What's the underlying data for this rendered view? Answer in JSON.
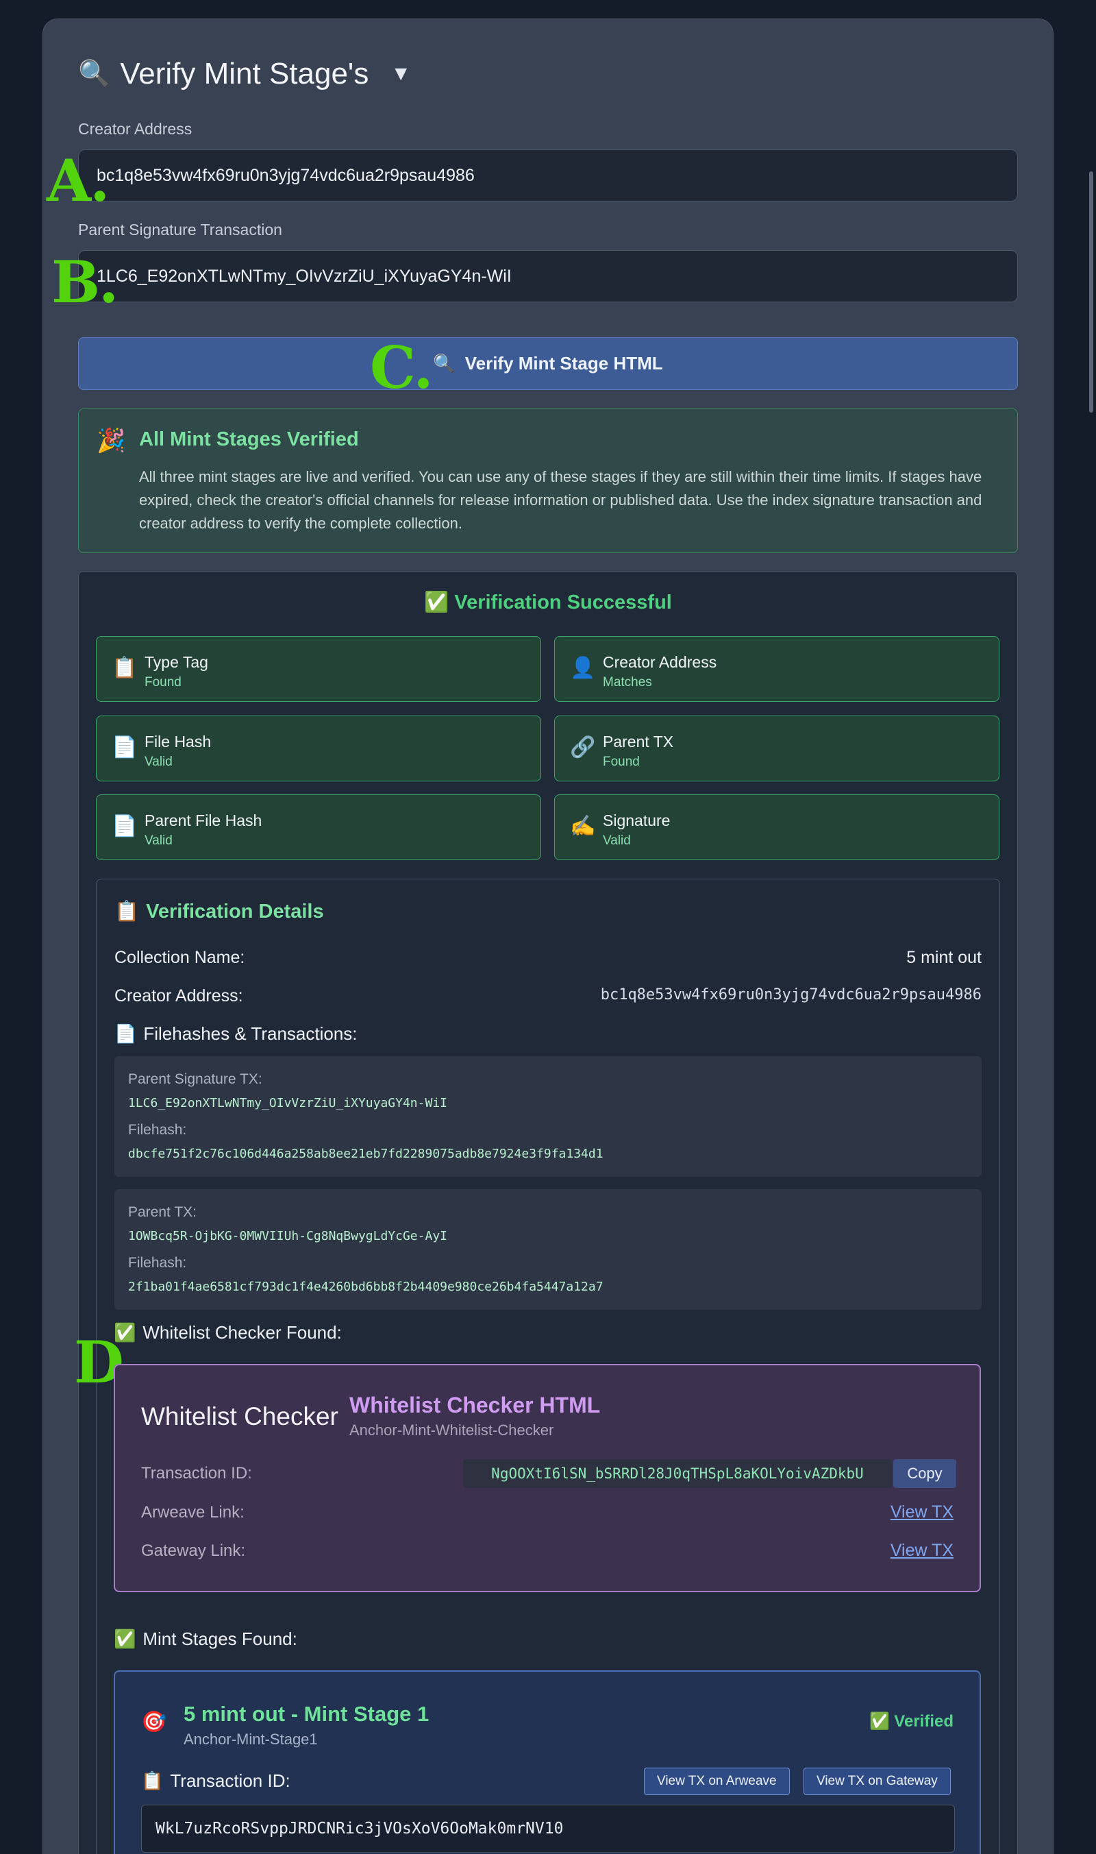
{
  "header": {
    "icon": "magnifier-icon",
    "title": "Verify Mint Stage's",
    "toggle_icon": "triangle-down-icon"
  },
  "form": {
    "creator_label": "Creator Address",
    "creator_value": "bc1q8e53vw4fx69ru0n3yjg74vdc6ua2r9psau4986",
    "parent_label": "Parent Signature Transaction",
    "parent_value": "1LC6_E92onXTLwNTmy_OIvVzrZiU_iXYuyaGY4n-WiI",
    "verify_icon": "magnifier-icon",
    "verify_label": "Verify Mint Stage HTML"
  },
  "annotations": {
    "a": "A.",
    "b": "B.",
    "c": "C.",
    "d": "D."
  },
  "alert": {
    "icon": "party-popper-icon",
    "title": "All Mint Stages Verified",
    "text": "All three mint stages are live and verified. You can use any of these stages if they are still within their time limits. If stages have expired, check the creator's official channels for release information or published data. Use the index signature transaction and creator address to verify the complete collection."
  },
  "verification": {
    "title": "✅ Verification Successful",
    "checks": [
      {
        "icon": "clipboard-icon",
        "name": "Type Tag",
        "status": "Found"
      },
      {
        "icon": "user-icon",
        "name": "Creator Address",
        "status": "Matches"
      },
      {
        "icon": "document-icon",
        "name": "File Hash",
        "status": "Valid"
      },
      {
        "icon": "link-icon",
        "name": "Parent TX",
        "status": "Found"
      },
      {
        "icon": "document-icon",
        "name": "Parent File Hash",
        "status": "Valid"
      },
      {
        "icon": "writing-hand-icon",
        "name": "Signature",
        "status": "Valid"
      }
    ]
  },
  "details": {
    "title": "Verification Details",
    "collection_label": "Collection Name:",
    "collection_value": "5 mint out",
    "creator_label": "Creator Address:",
    "creator_value": "bc1q8e53vw4fx69ru0n3yjg74vdc6ua2r9psau4986",
    "filehashes_title": "Filehashes & Transactions:",
    "blocks": [
      {
        "k1": "Parent Signature TX:",
        "v1": "1LC6_E92onXTLwNTmy_OIvVzrZiU_iXYuyaGY4n-WiI",
        "k2": "Filehash:",
        "v2": "dbcfe751f2c76c106d446a258ab8ee21eb7fd2289075adb8e7924e3f9fa134d1"
      },
      {
        "k1": "Parent TX:",
        "v1": "1OWBcq5R-OjbKG-0MWVIIUh-Cg8NqBwygLdYcGe-AyI",
        "k2": "Filehash:",
        "v2": "2f1ba01f4ae6581cf793dc1f4e4260bd6bb8f2b4409e980ce26b4fa5447a12a7"
      }
    ]
  },
  "whitelist": {
    "section_title": "Whitelist Checker Found:",
    "heading": "Whitelist Checker",
    "name": "Whitelist Checker HTML",
    "subtitle": "Anchor-Mint-Whitelist-Checker",
    "tx_label": "Transaction ID:",
    "tx_value": "NgOOXtI6lSN_bSRRDl28J0qTHSpL8aKOLYoivAZDkbU",
    "copy_label": "Copy",
    "arweave_label": "Arweave Link:",
    "arweave_link": "View TX",
    "gateway_label": "Gateway Link:",
    "gateway_link": "View TX"
  },
  "mint_stages": {
    "section_title": "Mint Stages Found:",
    "stage": {
      "icon": "target-icon",
      "name": "5 mint out - Mint Stage 1",
      "subtitle": "Anchor-Mint-Stage1",
      "verified": "Verified",
      "tx_label": "Transaction ID:",
      "btn_arweave": "View TX on Arweave",
      "btn_gateway": "View TX on Gateway",
      "tx_value": "WkL7uzRcoRSvppJRDCNRic3jVOsXoV6OoMak0mrNV10"
    }
  },
  "colors": {
    "background": "#141b29",
    "panel": "#394252",
    "accent_green": "#4fd27f",
    "annotation": "#52d30c",
    "button_blue": "#3d5c96",
    "purple": "#cf9cf2"
  }
}
